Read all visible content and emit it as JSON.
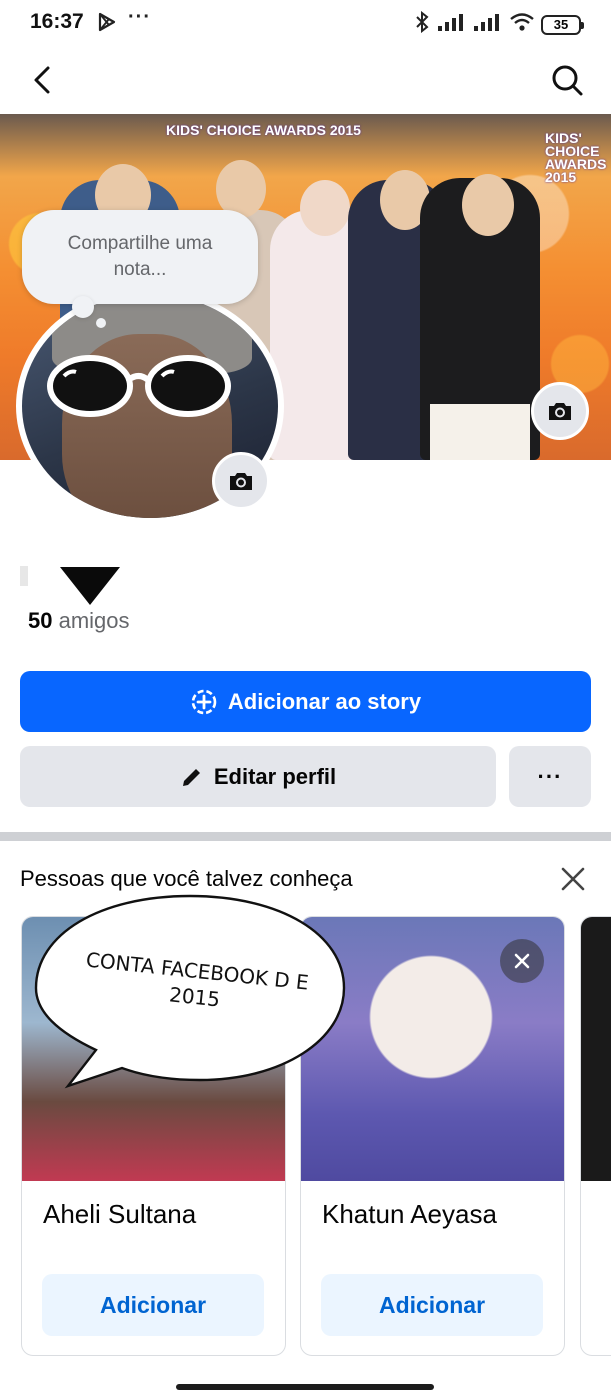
{
  "status_bar": {
    "time": "16:37",
    "dots": "···",
    "battery": "35"
  },
  "note": {
    "placeholder": "Compartilhe uma nota..."
  },
  "cover": {
    "kca_left": "KIDS' CHOICE AWARDS 2015",
    "kca_right": "KIDS' CHOICE AWARDS 2015"
  },
  "profile": {
    "friends_count": "50",
    "friends_label": "amigos"
  },
  "actions": {
    "add_story": "Adicionar ao story",
    "edit_profile": "Editar perfil",
    "more": "···"
  },
  "pymk": {
    "title": "Pessoas que você talvez conheça",
    "cards": [
      {
        "name": "Aheli Sultana",
        "button": "Adicionar"
      },
      {
        "name": "Khatun Aeyasa",
        "button": "Adicionar"
      }
    ]
  },
  "sticker": {
    "text": "CONTA FACEBOOK D E 2015"
  },
  "colors": {
    "primary_blue": "#0866ff",
    "secondary_gray": "#e4e6eb",
    "add_button_bg": "#ebf5ff",
    "add_button_text": "#0064d1"
  },
  "icons": {
    "back": "back-arrow-icon",
    "search": "search-icon",
    "camera": "camera-icon",
    "add_story": "add-circle-icon",
    "edit": "pencil-icon",
    "close": "close-icon"
  }
}
